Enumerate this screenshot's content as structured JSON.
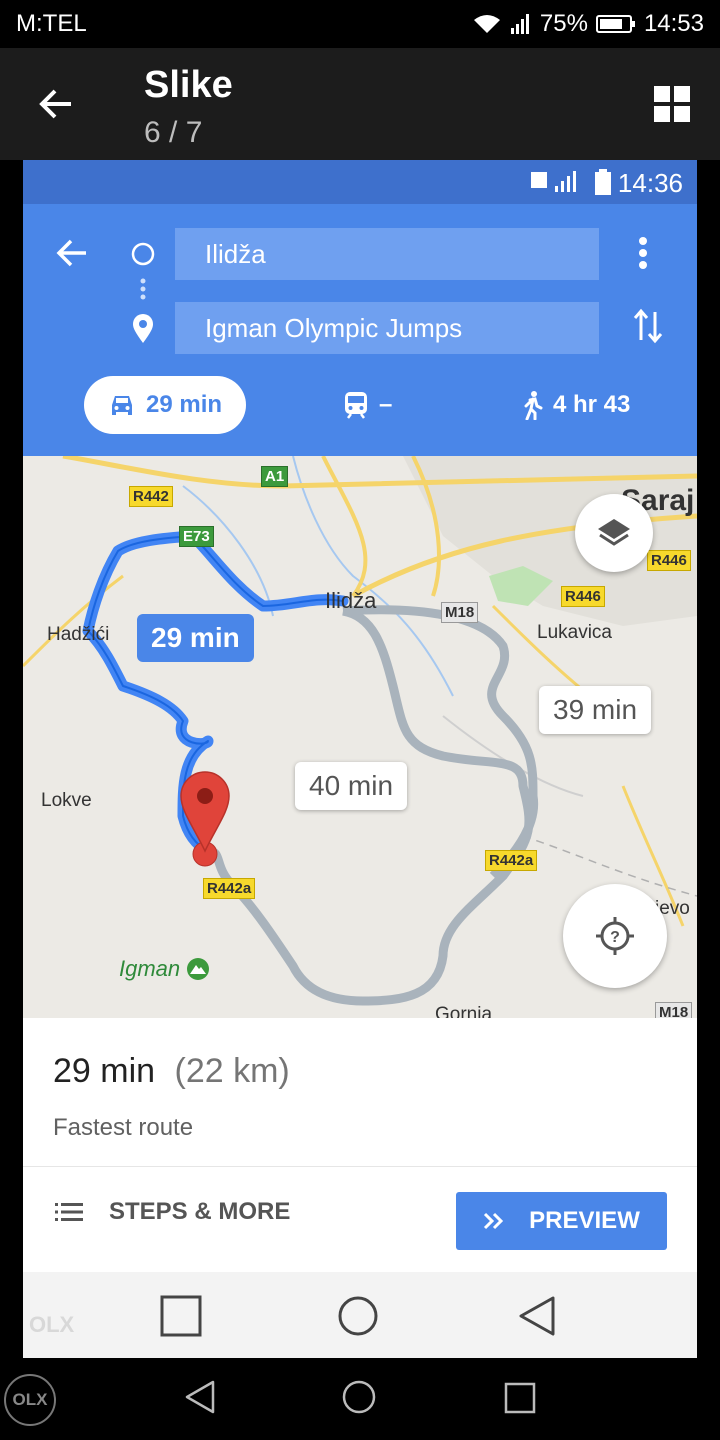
{
  "outer_status": {
    "carrier": "M:TEL",
    "battery": "75%",
    "time": "14:53"
  },
  "gallery": {
    "title": "Slike",
    "counter": "6 / 7"
  },
  "inner_status": {
    "time": "14:36"
  },
  "directions": {
    "origin": "Ilidža",
    "destination": "Igman Olympic Jumps",
    "modes": {
      "drive": "29 min",
      "transit": "–",
      "walk": "4 hr 43"
    }
  },
  "map": {
    "routes": {
      "fastest": "29 min",
      "alt1": "39 min",
      "alt2": "40 min"
    },
    "places": {
      "ilidza": "Ilidža",
      "hadzici": "Hadžići",
      "lukavica": "Lukavica",
      "lokve": "Lokve",
      "igman": "Igman",
      "sarajevo": "Saraj",
      "gornja": "Gornja",
      "ievo": "ievo"
    },
    "roads": {
      "r442_a": "R442",
      "a1": "A1",
      "e73": "E73",
      "m18_a": "M18",
      "r446_a": "R446",
      "r446_b": "R446",
      "r442a_a": "R442a",
      "r442a_b": "R442a",
      "m18_b": "M18"
    }
  },
  "summary": {
    "duration": "29 min",
    "distance": "(22 km)",
    "subtitle": "Fastest route"
  },
  "actions": {
    "steps": "STEPS & MORE",
    "preview": "PREVIEW"
  },
  "watermark": "OLX",
  "colors": {
    "blue": "#4a86e8",
    "route": "#4285f4",
    "alt_route": "#a9b3bc",
    "pin": "#e0443a"
  }
}
